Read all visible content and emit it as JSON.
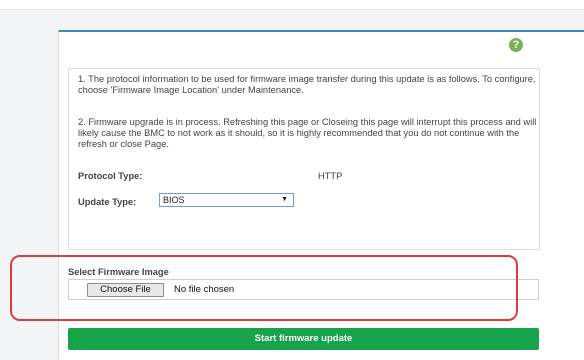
{
  "help": {
    "icon": "question-circle-icon",
    "glyph": "?",
    "color": "#7bb254"
  },
  "info": {
    "paragraph1": "1. The protocol information to be used for firmware image transfer during this update is as follows. To configure, choose 'Firmware Image Location' under Maintenance.",
    "paragraph2": "2. Firmware upgrade is in process. Refreshing this page or Closeing this page will interrupt this process and will likely cause the BMC to not work as it should, so it is highly recommended that you do not continue with the refresh or close Page.",
    "protocol_type_label": "Protocol Type:",
    "protocol_type_value": "HTTP",
    "update_type_label": "Update Type:",
    "update_type_value": "BIOS",
    "select_arrow": "▼"
  },
  "firmware": {
    "label": "Select Firmware Image",
    "choose_button": "Choose File",
    "no_file_text": "No file chosen"
  },
  "actions": {
    "start_button": "Start firmware update"
  },
  "colors": {
    "accent": "#3c8dbc",
    "success": "#17a34a",
    "highlight": "#e23b3b"
  }
}
